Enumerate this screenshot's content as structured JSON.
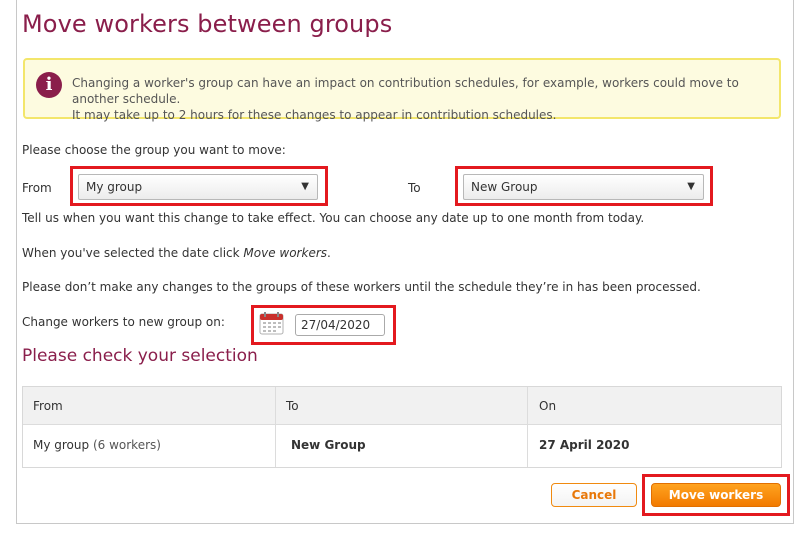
{
  "page": {
    "title": "Move workers between groups"
  },
  "notice": {
    "icon": "info-icon",
    "icon_glyph": "i",
    "line1": "Changing a worker's group can have an impact on contribution schedules, for example, workers could move to another schedule.",
    "line2": "It may take up to 2 hours for these changes to appear in contribution schedules."
  },
  "form": {
    "choose_label": "Please choose the group you want to move:",
    "from_label": "From",
    "from_value": "My group",
    "to_label": "To",
    "to_value": "New Group",
    "effect_text": "Tell us when you want this change to take effect. You can choose any date up to one month from today.",
    "selected_prefix": "When you've selected the date click ",
    "selected_action": "Move workers",
    "selected_suffix": ".",
    "warning_text": "Please don’t make any changes to the groups of these workers until the schedule they’re in has been processed.",
    "date_label": "Change workers to new group on:",
    "date_value": "27/04/2020"
  },
  "selection": {
    "title": "Please check your selection",
    "headers": [
      "From",
      "To",
      "On"
    ],
    "row": {
      "from_group": "My group",
      "from_count": "(6 workers)",
      "to_group": "New Group",
      "on_date": "27 April 2020"
    }
  },
  "actions": {
    "cancel_label": "Cancel",
    "move_label": "Move workers"
  },
  "colors": {
    "brand": "#8a1e4b",
    "highlight": "#e3191f",
    "primary_button": "#f27a00",
    "notice_border": "#f3e66b"
  }
}
